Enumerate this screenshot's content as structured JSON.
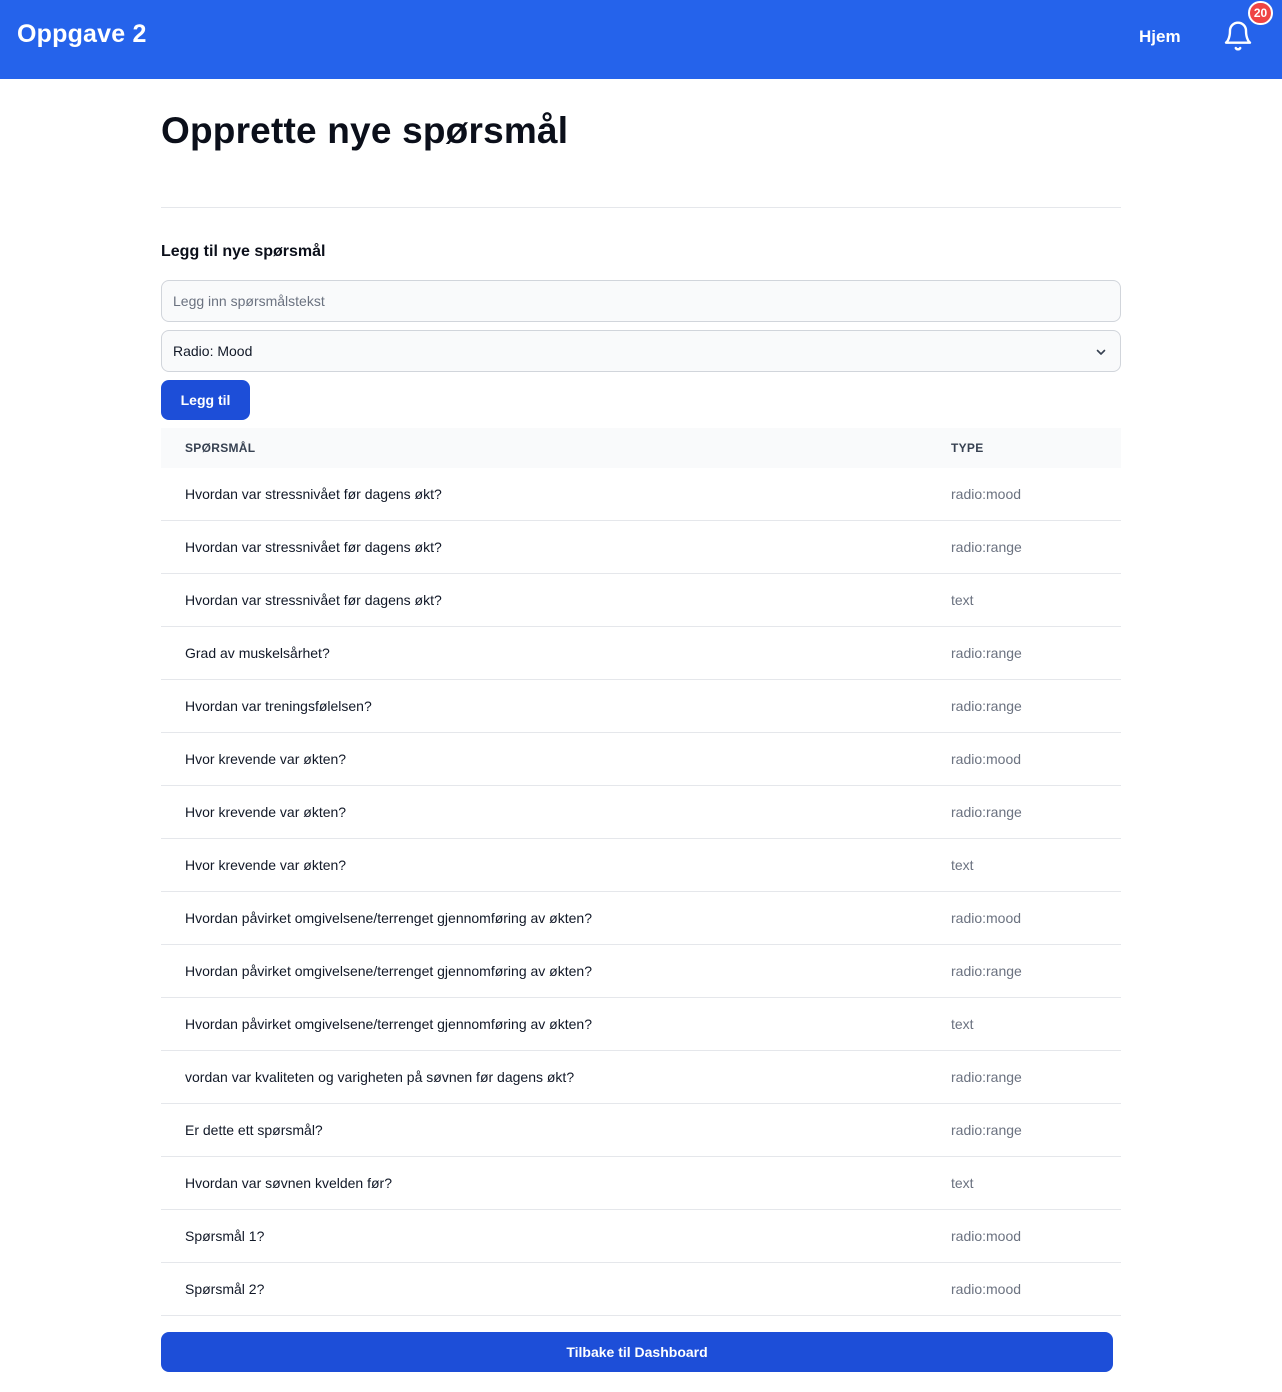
{
  "navbar": {
    "brand": "Oppgave 2",
    "home_label": "Hjem",
    "notification_count": "20",
    "bell_icon": "bell-icon",
    "color": "#2563eb"
  },
  "page": {
    "title": "Opprette nye spørsmål",
    "section_title": "Legg til nye spørsmål"
  },
  "form": {
    "question_placeholder": "Legg inn spørsmålstekst",
    "question_value": "",
    "type_selected": "Radio: Mood",
    "add_button_label": "Legg til"
  },
  "table": {
    "headers": {
      "question": "SPØRSMÅL",
      "type": "TYPE"
    },
    "rows": [
      {
        "question": "Hvordan var stressnivået før dagens økt?",
        "type": "radio:mood"
      },
      {
        "question": "Hvordan var stressnivået før dagens økt?",
        "type": "radio:range"
      },
      {
        "question": "Hvordan var stressnivået før dagens økt?",
        "type": "text"
      },
      {
        "question": "Grad av muskelsårhet?",
        "type": "radio:range"
      },
      {
        "question": "Hvordan var treningsfølelsen?",
        "type": "radio:range"
      },
      {
        "question": "Hvor krevende var økten?",
        "type": "radio:mood"
      },
      {
        "question": "Hvor krevende var økten?",
        "type": "radio:range"
      },
      {
        "question": "Hvor krevende var økten?",
        "type": "text"
      },
      {
        "question": "Hvordan påvirket omgivelsene/terrenget gjennomføring av økten?",
        "type": "radio:mood"
      },
      {
        "question": "Hvordan påvirket omgivelsene/terrenget gjennomføring av økten?",
        "type": "radio:range"
      },
      {
        "question": "Hvordan påvirket omgivelsene/terrenget gjennomføring av økten?",
        "type": "text"
      },
      {
        "question": "vordan var kvaliteten og varigheten på søvnen før dagens økt?",
        "type": "radio:range"
      },
      {
        "question": "Er dette ett spørsmål?",
        "type": "radio:range"
      },
      {
        "question": "Hvordan var søvnen kvelden før?",
        "type": "text"
      },
      {
        "question": "Spørsmål 1?",
        "type": "radio:mood"
      },
      {
        "question": "Spørsmål 2?",
        "type": "radio:mood"
      }
    ]
  },
  "footer": {
    "back_button_label": "Tilbake til Dashboard"
  }
}
